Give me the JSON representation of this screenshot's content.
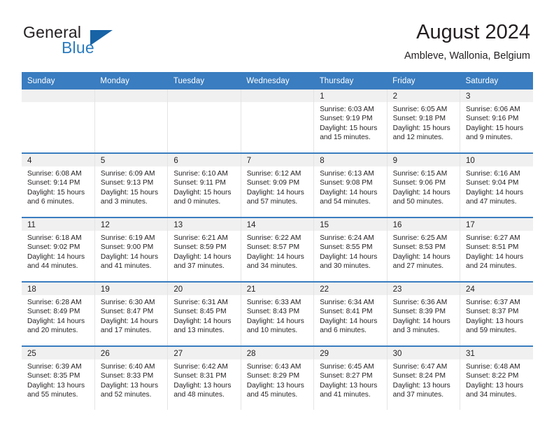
{
  "brand": {
    "name_top": "General",
    "name_bottom": "Blue",
    "triangle_color": "#1863a6",
    "blue_color": "#2b7cc0"
  },
  "header": {
    "title": "August 2024",
    "location": "Ambleve, Wallonia, Belgium"
  },
  "theme": {
    "header_blue": "#3a7dc0",
    "date_band": "#f0f0f0",
    "text": "#231f20"
  },
  "weekdays": [
    "Sunday",
    "Monday",
    "Tuesday",
    "Wednesday",
    "Thursday",
    "Friday",
    "Saturday"
  ],
  "weeks": [
    [
      {
        "day": "",
        "empty": true
      },
      {
        "day": "",
        "empty": true
      },
      {
        "day": "",
        "empty": true
      },
      {
        "day": "",
        "empty": true
      },
      {
        "day": "1",
        "sunrise": "Sunrise: 6:03 AM",
        "sunset": "Sunset: 9:19 PM",
        "daylight1": "Daylight: 15 hours",
        "daylight2": "and 15 minutes."
      },
      {
        "day": "2",
        "sunrise": "Sunrise: 6:05 AM",
        "sunset": "Sunset: 9:18 PM",
        "daylight1": "Daylight: 15 hours",
        "daylight2": "and 12 minutes."
      },
      {
        "day": "3",
        "sunrise": "Sunrise: 6:06 AM",
        "sunset": "Sunset: 9:16 PM",
        "daylight1": "Daylight: 15 hours",
        "daylight2": "and 9 minutes."
      }
    ],
    [
      {
        "day": "4",
        "sunrise": "Sunrise: 6:08 AM",
        "sunset": "Sunset: 9:14 PM",
        "daylight1": "Daylight: 15 hours",
        "daylight2": "and 6 minutes."
      },
      {
        "day": "5",
        "sunrise": "Sunrise: 6:09 AM",
        "sunset": "Sunset: 9:13 PM",
        "daylight1": "Daylight: 15 hours",
        "daylight2": "and 3 minutes."
      },
      {
        "day": "6",
        "sunrise": "Sunrise: 6:10 AM",
        "sunset": "Sunset: 9:11 PM",
        "daylight1": "Daylight: 15 hours",
        "daylight2": "and 0 minutes."
      },
      {
        "day": "7",
        "sunrise": "Sunrise: 6:12 AM",
        "sunset": "Sunset: 9:09 PM",
        "daylight1": "Daylight: 14 hours",
        "daylight2": "and 57 minutes."
      },
      {
        "day": "8",
        "sunrise": "Sunrise: 6:13 AM",
        "sunset": "Sunset: 9:08 PM",
        "daylight1": "Daylight: 14 hours",
        "daylight2": "and 54 minutes."
      },
      {
        "day": "9",
        "sunrise": "Sunrise: 6:15 AM",
        "sunset": "Sunset: 9:06 PM",
        "daylight1": "Daylight: 14 hours",
        "daylight2": "and 50 minutes."
      },
      {
        "day": "10",
        "sunrise": "Sunrise: 6:16 AM",
        "sunset": "Sunset: 9:04 PM",
        "daylight1": "Daylight: 14 hours",
        "daylight2": "and 47 minutes."
      }
    ],
    [
      {
        "day": "11",
        "sunrise": "Sunrise: 6:18 AM",
        "sunset": "Sunset: 9:02 PM",
        "daylight1": "Daylight: 14 hours",
        "daylight2": "and 44 minutes."
      },
      {
        "day": "12",
        "sunrise": "Sunrise: 6:19 AM",
        "sunset": "Sunset: 9:00 PM",
        "daylight1": "Daylight: 14 hours",
        "daylight2": "and 41 minutes."
      },
      {
        "day": "13",
        "sunrise": "Sunrise: 6:21 AM",
        "sunset": "Sunset: 8:59 PM",
        "daylight1": "Daylight: 14 hours",
        "daylight2": "and 37 minutes."
      },
      {
        "day": "14",
        "sunrise": "Sunrise: 6:22 AM",
        "sunset": "Sunset: 8:57 PM",
        "daylight1": "Daylight: 14 hours",
        "daylight2": "and 34 minutes."
      },
      {
        "day": "15",
        "sunrise": "Sunrise: 6:24 AM",
        "sunset": "Sunset: 8:55 PM",
        "daylight1": "Daylight: 14 hours",
        "daylight2": "and 30 minutes."
      },
      {
        "day": "16",
        "sunrise": "Sunrise: 6:25 AM",
        "sunset": "Sunset: 8:53 PM",
        "daylight1": "Daylight: 14 hours",
        "daylight2": "and 27 minutes."
      },
      {
        "day": "17",
        "sunrise": "Sunrise: 6:27 AM",
        "sunset": "Sunset: 8:51 PM",
        "daylight1": "Daylight: 14 hours",
        "daylight2": "and 24 minutes."
      }
    ],
    [
      {
        "day": "18",
        "sunrise": "Sunrise: 6:28 AM",
        "sunset": "Sunset: 8:49 PM",
        "daylight1": "Daylight: 14 hours",
        "daylight2": "and 20 minutes."
      },
      {
        "day": "19",
        "sunrise": "Sunrise: 6:30 AM",
        "sunset": "Sunset: 8:47 PM",
        "daylight1": "Daylight: 14 hours",
        "daylight2": "and 17 minutes."
      },
      {
        "day": "20",
        "sunrise": "Sunrise: 6:31 AM",
        "sunset": "Sunset: 8:45 PM",
        "daylight1": "Daylight: 14 hours",
        "daylight2": "and 13 minutes."
      },
      {
        "day": "21",
        "sunrise": "Sunrise: 6:33 AM",
        "sunset": "Sunset: 8:43 PM",
        "daylight1": "Daylight: 14 hours",
        "daylight2": "and 10 minutes."
      },
      {
        "day": "22",
        "sunrise": "Sunrise: 6:34 AM",
        "sunset": "Sunset: 8:41 PM",
        "daylight1": "Daylight: 14 hours",
        "daylight2": "and 6 minutes."
      },
      {
        "day": "23",
        "sunrise": "Sunrise: 6:36 AM",
        "sunset": "Sunset: 8:39 PM",
        "daylight1": "Daylight: 14 hours",
        "daylight2": "and 3 minutes."
      },
      {
        "day": "24",
        "sunrise": "Sunrise: 6:37 AM",
        "sunset": "Sunset: 8:37 PM",
        "daylight1": "Daylight: 13 hours",
        "daylight2": "and 59 minutes."
      }
    ],
    [
      {
        "day": "25",
        "sunrise": "Sunrise: 6:39 AM",
        "sunset": "Sunset: 8:35 PM",
        "daylight1": "Daylight: 13 hours",
        "daylight2": "and 55 minutes."
      },
      {
        "day": "26",
        "sunrise": "Sunrise: 6:40 AM",
        "sunset": "Sunset: 8:33 PM",
        "daylight1": "Daylight: 13 hours",
        "daylight2": "and 52 minutes."
      },
      {
        "day": "27",
        "sunrise": "Sunrise: 6:42 AM",
        "sunset": "Sunset: 8:31 PM",
        "daylight1": "Daylight: 13 hours",
        "daylight2": "and 48 minutes."
      },
      {
        "day": "28",
        "sunrise": "Sunrise: 6:43 AM",
        "sunset": "Sunset: 8:29 PM",
        "daylight1": "Daylight: 13 hours",
        "daylight2": "and 45 minutes."
      },
      {
        "day": "29",
        "sunrise": "Sunrise: 6:45 AM",
        "sunset": "Sunset: 8:27 PM",
        "daylight1": "Daylight: 13 hours",
        "daylight2": "and 41 minutes."
      },
      {
        "day": "30",
        "sunrise": "Sunrise: 6:47 AM",
        "sunset": "Sunset: 8:24 PM",
        "daylight1": "Daylight: 13 hours",
        "daylight2": "and 37 minutes."
      },
      {
        "day": "31",
        "sunrise": "Sunrise: 6:48 AM",
        "sunset": "Sunset: 8:22 PM",
        "daylight1": "Daylight: 13 hours",
        "daylight2": "and 34 minutes."
      }
    ]
  ]
}
